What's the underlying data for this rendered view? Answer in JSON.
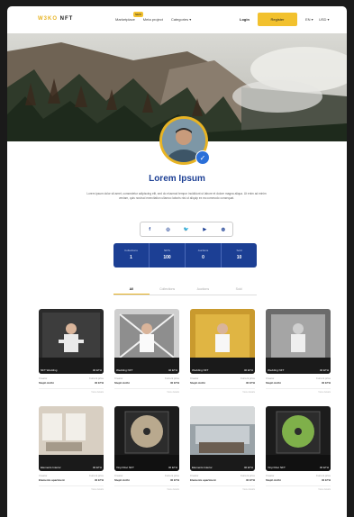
{
  "brand": {
    "part1": "W3KO",
    "part2": "NFT"
  },
  "nav": {
    "links": [
      "Marketplace",
      "Meta project",
      "Categories ▾"
    ],
    "new_badge": "NEW",
    "login": "Login",
    "register": "Register",
    "language": "EN ▾",
    "currency": "USD ▾"
  },
  "profile": {
    "name": "Lorem Ipsum",
    "bio": "Lorem ipsum dolor sit amet, consectetur adipiscing elit, sed do eiusmod tempor incididunt ut labore et dolore magna aliqua. Ut enim ad minim veniam, quis nostrud exercitation ullamco laboris nisi ut aliquip ex ea commodo consequat."
  },
  "socials": [
    "f",
    "◎",
    "🐦",
    "▶",
    "◍"
  ],
  "stats": [
    {
      "label": "Collections",
      "value": "1"
    },
    {
      "label": "NFTs",
      "value": "100"
    },
    {
      "label": "Auctions",
      "value": "0"
    },
    {
      "label": "Sold",
      "value": "10"
    }
  ],
  "tabs": [
    "All",
    "Collections",
    "Auctions",
    "Sold"
  ],
  "cards": [
    {
      "title": "NFT Wedding",
      "price": "40 ETH",
      "creator_label": "Creator",
      "creator": "Steph Anthi",
      "price_label": "Current price",
      "price_value": "40 ETH",
      "foot": "View details"
    },
    {
      "title": "Wedding NFT",
      "price": "40 ETH",
      "creator_label": "Creator",
      "creator": "Steph Anthi",
      "price_label": "Current price",
      "price_value": "40 ETH",
      "foot": "View details"
    },
    {
      "title": "Wedding NFT",
      "price": "40 ETH",
      "creator_label": "Creator",
      "creator": "Steph Anthi",
      "price_label": "Current price",
      "price_value": "40 ETH",
      "foot": "View details"
    },
    {
      "title": "Wedding NFT",
      "price": "40 ETH",
      "creator_label": "Creator",
      "creator": "Steph Anthi",
      "price_label": "Current price",
      "price_value": "40 ETH",
      "foot": "View details"
    },
    {
      "title": "Elements Interior",
      "price": "40 ETH",
      "creator_label": "Creator",
      "creator": "Elements apartment",
      "price_label": "Current price",
      "price_value": "40 ETH",
      "foot": "View details"
    },
    {
      "title": "Vinyl Disc NFT",
      "price": "40 ETH",
      "creator_label": "Creator",
      "creator": "Steph Anthi",
      "price_label": "Current price",
      "price_value": "40 ETH",
      "foot": "View details"
    },
    {
      "title": "Elements Interior",
      "price": "40 ETH",
      "creator_label": "Creator",
      "creator": "Elements apartment",
      "price_label": "Current price",
      "price_value": "40 ETH",
      "foot": "View details"
    },
    {
      "title": "Vinyl Disc NFT",
      "price": "40 ETH",
      "creator_label": "Creator",
      "creator": "Steph Anthi",
      "price_label": "Current price",
      "price_value": "40 ETH",
      "foot": "View details"
    }
  ],
  "colors": {
    "accent": "#f2c12e",
    "brand_blue": "#1c3f94",
    "background": "#1a1a1a"
  }
}
